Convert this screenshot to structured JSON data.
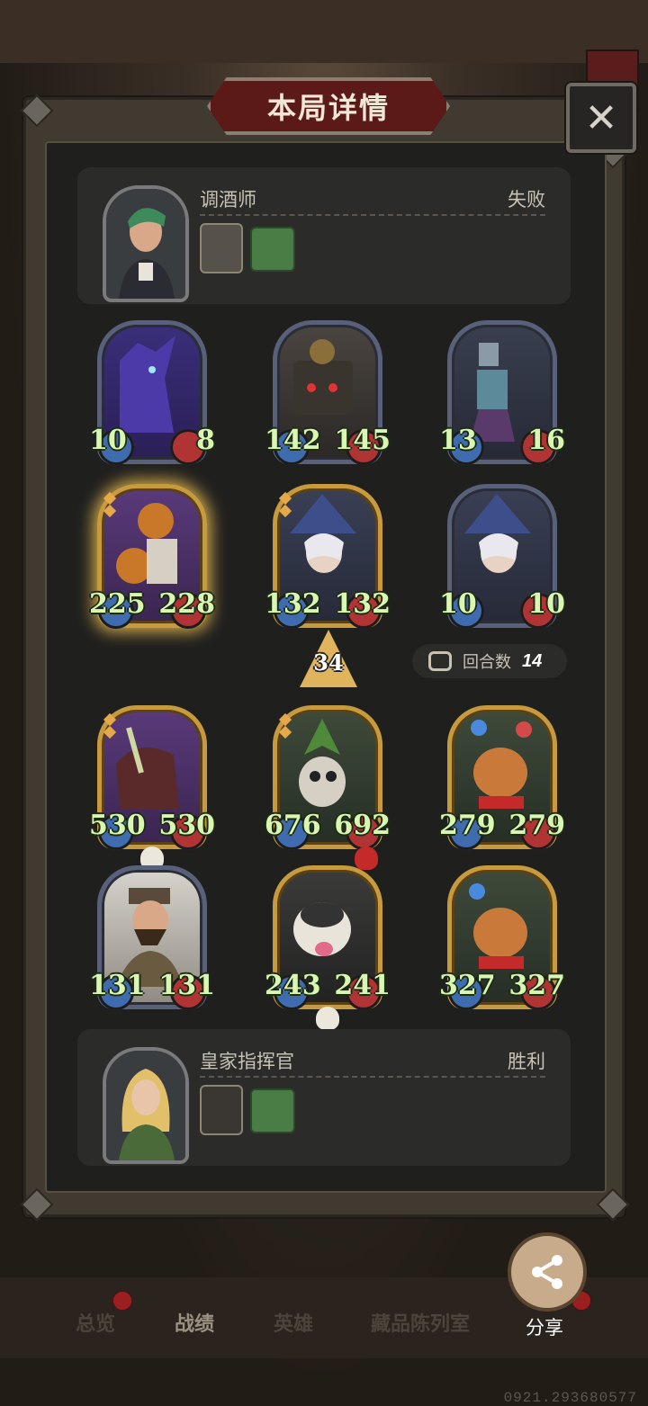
{
  "title": "本局详情",
  "top_player": {
    "name": "调酒师",
    "result": "失败"
  },
  "bottom_player": {
    "name": "皇家指挥官",
    "result": "胜利"
  },
  "enemy_units": [
    {
      "attack": "10",
      "health": "8"
    },
    {
      "attack": "142",
      "health": "145"
    },
    {
      "attack": "13",
      "health": "16"
    },
    {
      "attack": "225",
      "health": "228"
    },
    {
      "attack": "132",
      "health": "132"
    },
    {
      "attack": "10",
      "health": "10"
    }
  ],
  "ally_units": [
    {
      "attack": "530",
      "health": "530"
    },
    {
      "attack": "676",
      "health": "692"
    },
    {
      "attack": "279",
      "health": "279"
    },
    {
      "attack": "131",
      "health": "131"
    },
    {
      "attack": "243",
      "health": "241"
    },
    {
      "attack": "327",
      "health": "327"
    }
  ],
  "damage": "34",
  "round": {
    "label": "回合数",
    "value": "14"
  },
  "nav": {
    "overview": "总览",
    "record": "战绩",
    "heroes": "英雄",
    "collection": "藏品陈列室",
    "share": "分享"
  },
  "footer_id": "0921.293680577"
}
